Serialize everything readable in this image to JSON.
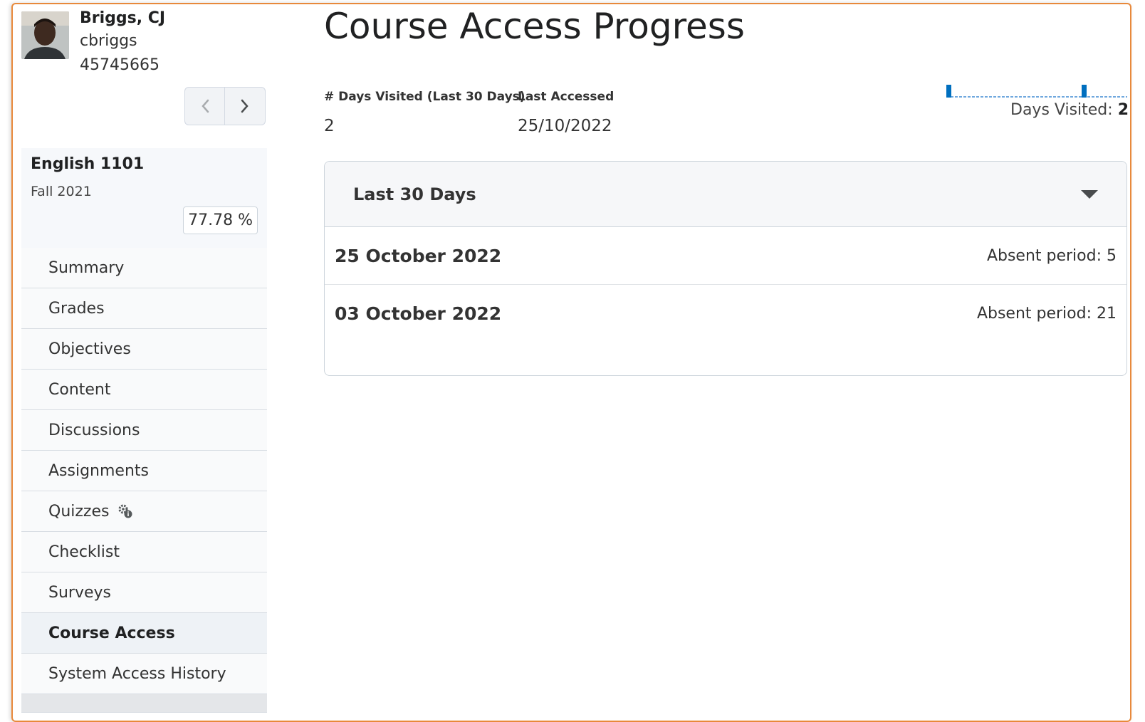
{
  "user": {
    "name": "Briggs, CJ",
    "username": "cbriggs",
    "id": "45745665"
  },
  "pager": {
    "prev_icon": "chevron-left-icon",
    "next_icon": "chevron-right-icon"
  },
  "course": {
    "name": "English 1101",
    "term": "Fall 2021",
    "grade": "77.78 %"
  },
  "nav": {
    "items": [
      {
        "label": "Summary"
      },
      {
        "label": "Grades"
      },
      {
        "label": "Objectives"
      },
      {
        "label": "Content"
      },
      {
        "label": "Discussions"
      },
      {
        "label": "Assignments"
      },
      {
        "label": "Quizzes",
        "icon": "gear-info-icon"
      },
      {
        "label": "Checklist"
      },
      {
        "label": "Surveys"
      },
      {
        "label": "Course Access",
        "active": true
      },
      {
        "label": "System Access History"
      }
    ]
  },
  "main": {
    "title": "Course Access Progress",
    "stats": {
      "days_visited_label": "# Days Visited (Last 30 Days)",
      "days_visited_value": "2",
      "last_accessed_label": "Last Accessed",
      "last_accessed_value": "25/10/2022"
    },
    "sparkline": {
      "caption_label": "Days Visited:",
      "caption_value": "2",
      "color": "#006fbf"
    },
    "panel": {
      "title": "Last 30 Days",
      "rows": [
        {
          "date": "25 October 2022",
          "period": "Absent period: 5"
        },
        {
          "date": "03 October 2022",
          "period": "Absent period: 21"
        }
      ]
    }
  }
}
